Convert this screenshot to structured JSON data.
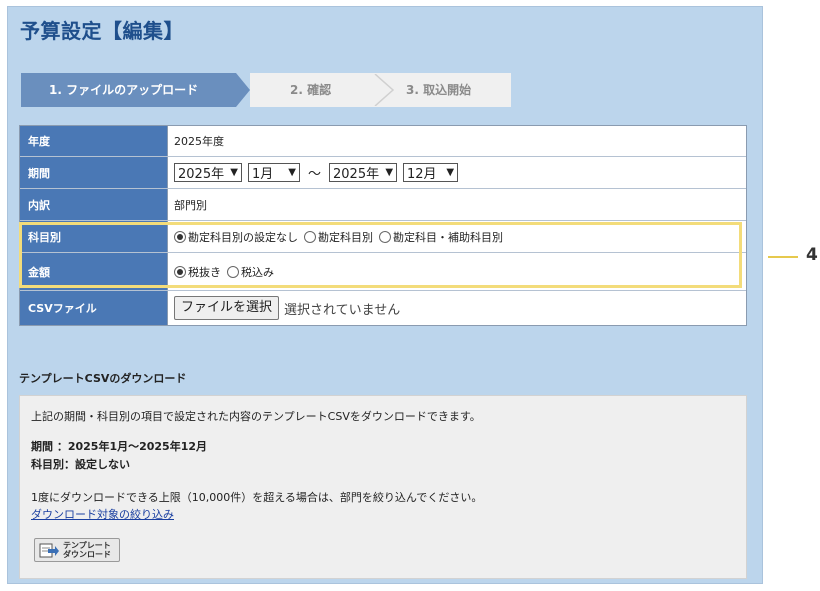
{
  "title": "予算設定【編集】",
  "steps": [
    {
      "label": "1. ファイルのアップロード",
      "active": true
    },
    {
      "label": "2. 確認",
      "active": false
    },
    {
      "label": "3. 取込開始",
      "active": false
    }
  ],
  "settings": {
    "year": {
      "label": "年度",
      "value": "2025年度"
    },
    "period": {
      "label": "期間",
      "start_year": "2025年",
      "start_month": "1月",
      "separator": "〜",
      "end_year": "2025年",
      "end_month": "12月"
    },
    "breakdown": {
      "label": "内訳",
      "value": "部門別"
    },
    "category": {
      "label": "科目別",
      "options": [
        "勘定科目別の設定なし",
        "勘定科目別",
        "勘定科目・補助科目別"
      ],
      "selected_index": 0
    },
    "amount": {
      "label": "金額",
      "options": [
        "税抜き",
        "税込み"
      ],
      "selected_index": 0
    },
    "csv": {
      "label": "CSVファイル",
      "button_label": "ファイルを選択",
      "status": "選択されていません"
    }
  },
  "callout": {
    "number": "4",
    "color": "#f3dc7a"
  },
  "template": {
    "heading": "テンプレートCSVのダウンロード",
    "description": "上記の期間・科目別の項目で設定された内容のテンプレートCSVをダウンロードできます。",
    "period_line": "期間 ：2025年1月〜2025年12月",
    "category_line": "科目別：設定しない",
    "note": "1度にダウンロードできる上限（10,000件）を超える場合は、部門を絞り込んでください。",
    "link_label": "ダウンロード対象の絞り込み",
    "button_line1": "テンプレート",
    "button_line2": "ダウンロード"
  },
  "colors": {
    "header_blue": "#4a78b5",
    "panel_bg": "#bcd5ec",
    "step_active": "#6a8fbe"
  }
}
